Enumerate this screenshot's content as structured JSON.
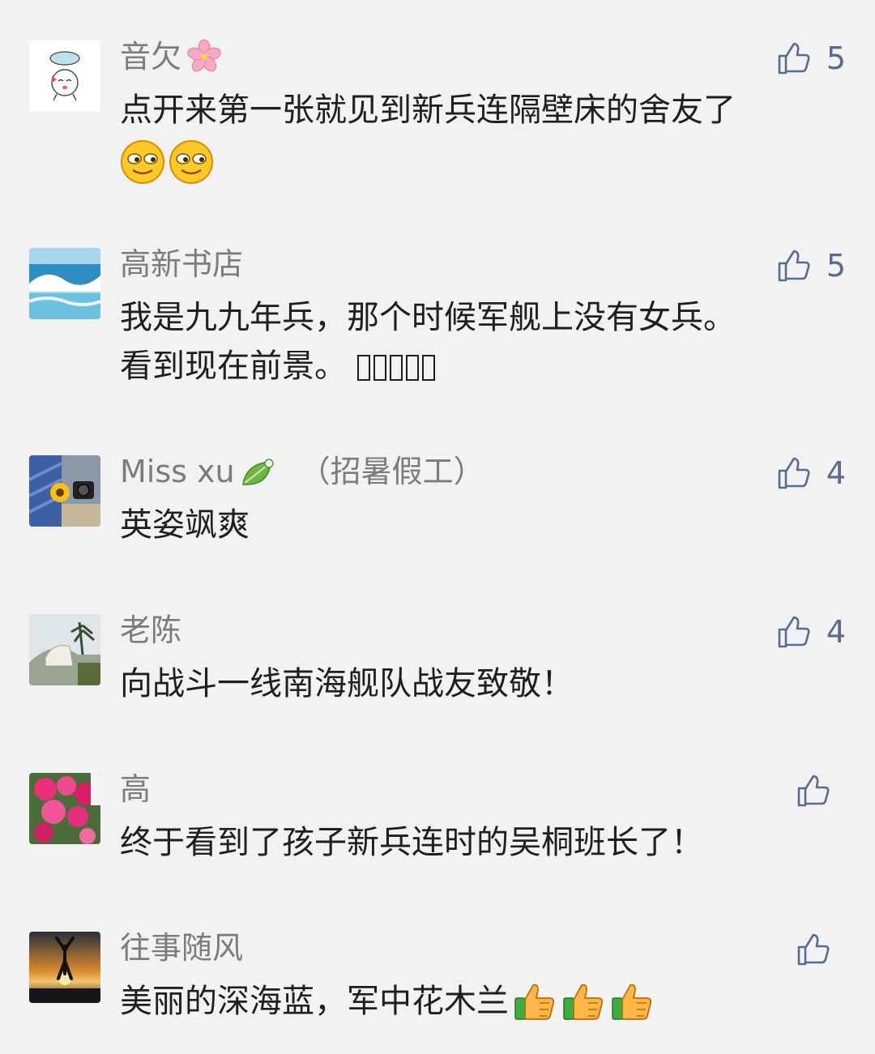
{
  "comments": [
    {
      "name": "音欠",
      "name_icon": "cherry-blossom-icon",
      "likes": "5",
      "text": "点开来第一张就见到新兵连隔壁床的舍友了",
      "emojis": [
        "squint-face-emoji",
        "squint-face-emoji"
      ]
    },
    {
      "name": "高新书店",
      "likes": "5",
      "text_line1": "我是九九年兵，那个时候军舰上没有女兵。",
      "text_line2": "看到现在前景。"
    },
    {
      "name": "Miss xu",
      "name_icon": "leaf-icon",
      "name_suffix": "（招暑假工）",
      "likes": "4",
      "text": "英姿飒爽"
    },
    {
      "name": "老陈",
      "likes": "4",
      "text": "向战斗一线南海舰队战友致敬！"
    },
    {
      "name": "高",
      "likes": "",
      "text": "终于看到了孩子新兵连时的吴桐班长了！"
    },
    {
      "name": "往事随风",
      "likes": "",
      "text": "美丽的深海蓝，军中花木兰",
      "emojis": [
        "thumbs-up-emoji",
        "thumbs-up-emoji",
        "thumbs-up-emoji"
      ]
    }
  ],
  "colors": {
    "background": "#f2f2f2",
    "name": "#7c7c7c",
    "text": "#1f1f1f",
    "like": "#576b95"
  }
}
